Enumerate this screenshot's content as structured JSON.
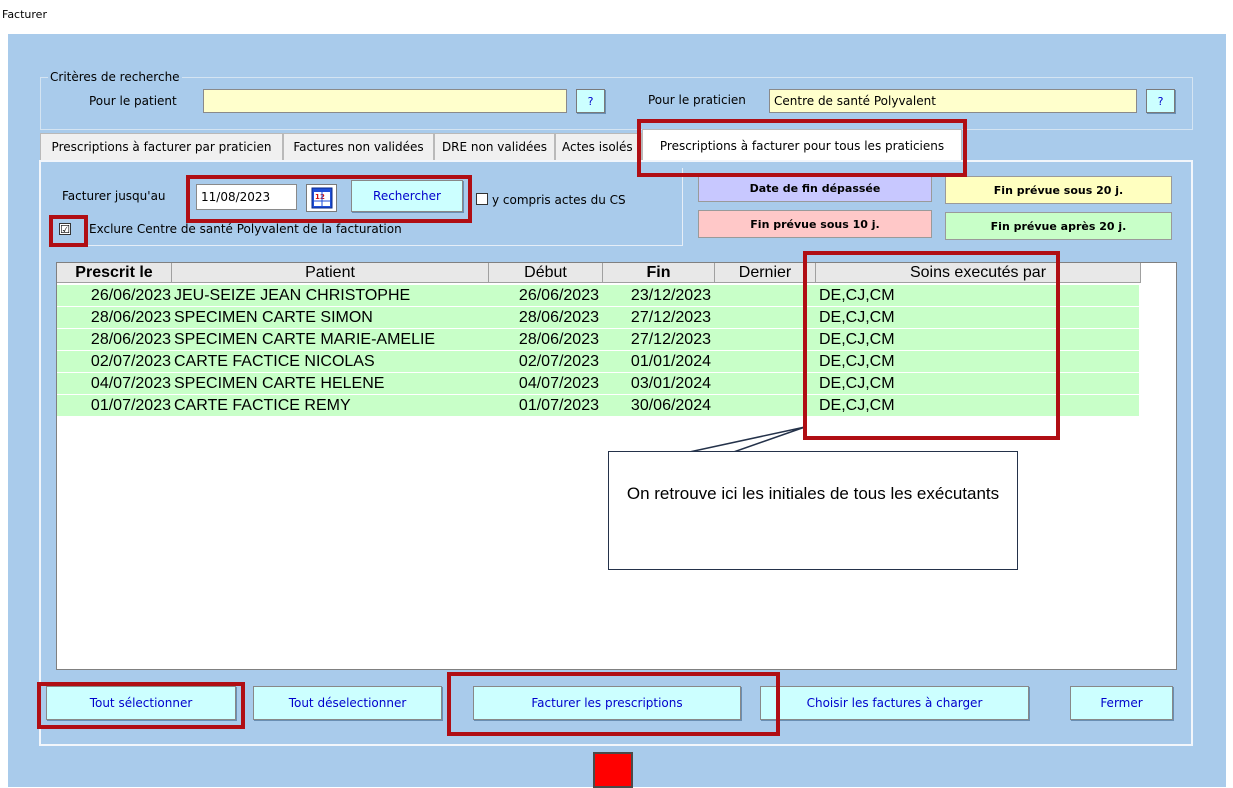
{
  "window": {
    "title": "Facturer"
  },
  "criteria": {
    "legend": "Critères de recherche",
    "patient_label": "Pour le patient",
    "patient_value": "",
    "patient_help": "?",
    "praticien_label": "Pour le praticien",
    "praticien_value": "Centre de santé Polyvalent",
    "praticien_help": "?"
  },
  "tabs": [
    {
      "label": "Prescriptions à facturer par praticien"
    },
    {
      "label": "Factures non validées"
    },
    {
      "label": "DRE non validées"
    },
    {
      "label": "Actes isolés"
    },
    {
      "label": "Prescriptions à facturer pour tous les praticiens",
      "active": true
    }
  ],
  "filters": {
    "date_label": "Facturer jusqu'au",
    "date_value": "11/08/2023",
    "calendar_icon": "calendar-icon",
    "search_label": "Rechercher",
    "include_cs_label": "y compris actes du CS",
    "include_cs_checked": false,
    "exclude_label": "Exclure Centre de santé Polyvalent de la facturation",
    "exclude_checked": true,
    "exclude_mark": "☑"
  },
  "legend_boxes": {
    "expired": {
      "label": "Date de fin dépassée",
      "color": "#c8c8ff"
    },
    "under20": {
      "label": "Fin prévue sous 20 j.",
      "color": "#ffffc0"
    },
    "under10": {
      "label": "Fin prévue sous 10 j.",
      "color": "#ffc8c8"
    },
    "after20": {
      "label": "Fin prévue après 20 j.",
      "color": "#c8ffc8"
    }
  },
  "table": {
    "headers": {
      "prescrit": "Prescrit le",
      "patient": "Patient",
      "debut": "Début",
      "fin": "Fin",
      "dernier": "Dernier",
      "soins": "Soins executés par"
    },
    "rows": [
      {
        "prescrit": "26/06/2023",
        "patient": "JEU-SEIZE JEAN CHRISTOPHE",
        "debut": "26/06/2023",
        "fin": "23/12/2023",
        "dernier": "",
        "soins": "DE,CJ,CM"
      },
      {
        "prescrit": "28/06/2023",
        "patient": "SPECIMEN CARTE SIMON",
        "debut": "28/06/2023",
        "fin": "27/12/2023",
        "dernier": "",
        "soins": "DE,CJ,CM"
      },
      {
        "prescrit": "28/06/2023",
        "patient": "SPECIMEN CARTE MARIE-AMELIE",
        "debut": "28/06/2023",
        "fin": "27/12/2023",
        "dernier": "",
        "soins": "DE,CJ,CM"
      },
      {
        "prescrit": "02/07/2023",
        "patient": "CARTE FACTICE NICOLAS",
        "debut": "02/07/2023",
        "fin": "01/01/2024",
        "dernier": "",
        "soins": "DE,CJ,CM"
      },
      {
        "prescrit": "04/07/2023",
        "patient": "SPECIMEN CARTE HELENE",
        "debut": "04/07/2023",
        "fin": "03/01/2024",
        "dernier": "",
        "soins": "DE,CJ,CM"
      },
      {
        "prescrit": "01/07/2023",
        "patient": "CARTE FACTICE REMY",
        "debut": "01/07/2023",
        "fin": "30/06/2024",
        "dernier": "",
        "soins": "DE,CJ,CM"
      }
    ]
  },
  "callout": {
    "text": "On retrouve ici les initiales de tous les exécutants"
  },
  "buttons": {
    "select_all": "Tout sélectionner",
    "deselect_all": "Tout déselectionner",
    "bill": "Facturer les prescriptions",
    "choose_invoices": "Choisir les factures à charger",
    "close": "Fermer"
  },
  "colors": {
    "window_bg": "#a9cbeb",
    "highlight": "#b00e14",
    "button_bg": "#ccffff",
    "row_green": "#c8ffc8"
  }
}
